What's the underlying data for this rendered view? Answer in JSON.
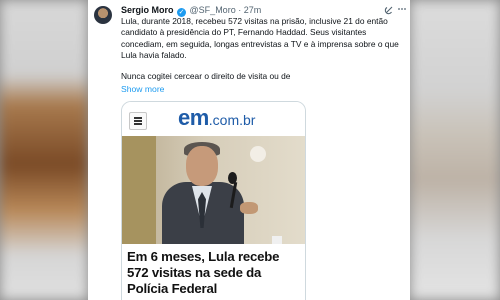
{
  "tweet": {
    "author_name": "Sergio Moro",
    "handle": "@SF_Moro",
    "separator": "·",
    "time": "27m",
    "paragraph_1": "Lula, durante 2018, recebeu 572 visitas na prisão, inclusive 21 do então candidato à presidência do PT, Fernando Haddad. Seus visitantes concediam, em seguida, longas entrevistas a TV e à imprensa sobre o que Lula havia falado.",
    "paragraph_2": "Nunca cogitei cercear o direito de visita ou de",
    "show_more": "Show more",
    "verified_glyph": "✓",
    "grok_icon": "grok-icon",
    "more_icon": "more-options-icon"
  },
  "card": {
    "menu_icon": "hamburger-menu-icon",
    "logo_brand": "em",
    "logo_domain": ".com.br",
    "headline": "Em 6 meses, Lula recebe 572 visitas na sede da Polícia Federal"
  },
  "colors": {
    "accent": "#1d9bf0",
    "brand": "#1f5ca8"
  }
}
